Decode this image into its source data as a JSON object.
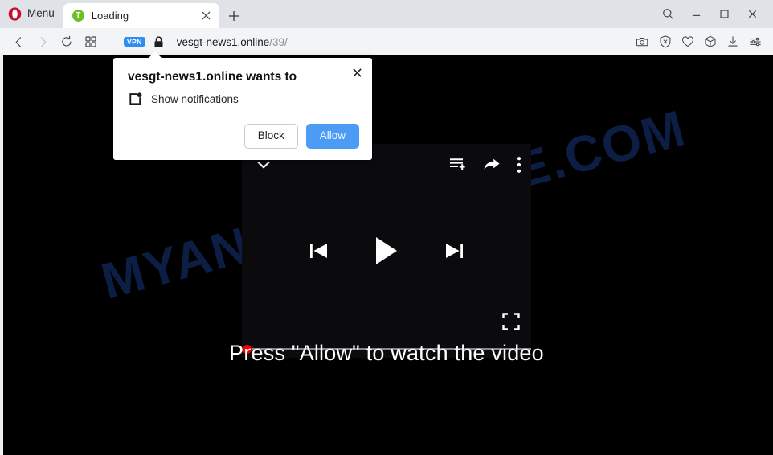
{
  "browser": {
    "name": "Opera",
    "menu_label": "Menu",
    "logo_icon": "opera-logo-icon",
    "accent_color": "#c8102e",
    "tabs": [
      {
        "title": "Loading",
        "favicon_icon": "site-favicon-icon",
        "favicon_letter": "T",
        "favicon_color": "#6cc024",
        "close_icon": "close-icon",
        "active": true
      }
    ],
    "new_tab_icon": "plus-icon",
    "window_controls": [
      {
        "name": "search-icon",
        "glyph": "search"
      },
      {
        "name": "minimize-icon",
        "glyph": "minimize"
      },
      {
        "name": "maximize-icon",
        "glyph": "maximize"
      },
      {
        "name": "close-window-icon",
        "glyph": "close"
      }
    ]
  },
  "navbar": {
    "back_icon": "back-icon",
    "forward_icon": "forward-icon",
    "reload_icon": "reload-icon",
    "speeddial_icon": "grid-icon",
    "vpn_badge": "VPN",
    "vpn_color": "#2f8ef4",
    "lock_icon": "lock-icon",
    "url_domain": "vesgt-news1.online",
    "url_path": "/39/",
    "right_icons": [
      {
        "name": "snapshot-camera-icon"
      },
      {
        "name": "ad-blocker-shield-icon"
      },
      {
        "name": "heart-favorite-icon"
      },
      {
        "name": "extensions-cube-icon"
      },
      {
        "name": "downloads-icon"
      },
      {
        "name": "easy-setup-sliders-icon"
      }
    ]
  },
  "permission_dialog": {
    "title": "vesgt-news1.online wants to",
    "permission_icon": "notifications-icon",
    "permission_label": "Show notifications",
    "block_label": "Block",
    "allow_label": "Allow",
    "allow_color": "#4c9cf5",
    "close_icon": "close-icon"
  },
  "page": {
    "background_color": "#000000",
    "watermark": "MYANTISPYWARE.COM",
    "watermark_color": "#0e2049",
    "cta_text": "Press \"Allow\" to watch the video",
    "player": {
      "background_color": "#0b0b0d",
      "collapse_icon": "chevron-down-icon",
      "playlist_add_icon": "playlist-add-icon",
      "share_icon": "share-icon",
      "more_icon": "kebab-menu-icon",
      "previous_icon": "skip-previous-icon",
      "play_icon": "play-icon",
      "next_icon": "skip-next-icon",
      "fullscreen_icon": "fullscreen-icon",
      "progress_percent": 0,
      "progress_dot_color": "#f10000"
    }
  }
}
